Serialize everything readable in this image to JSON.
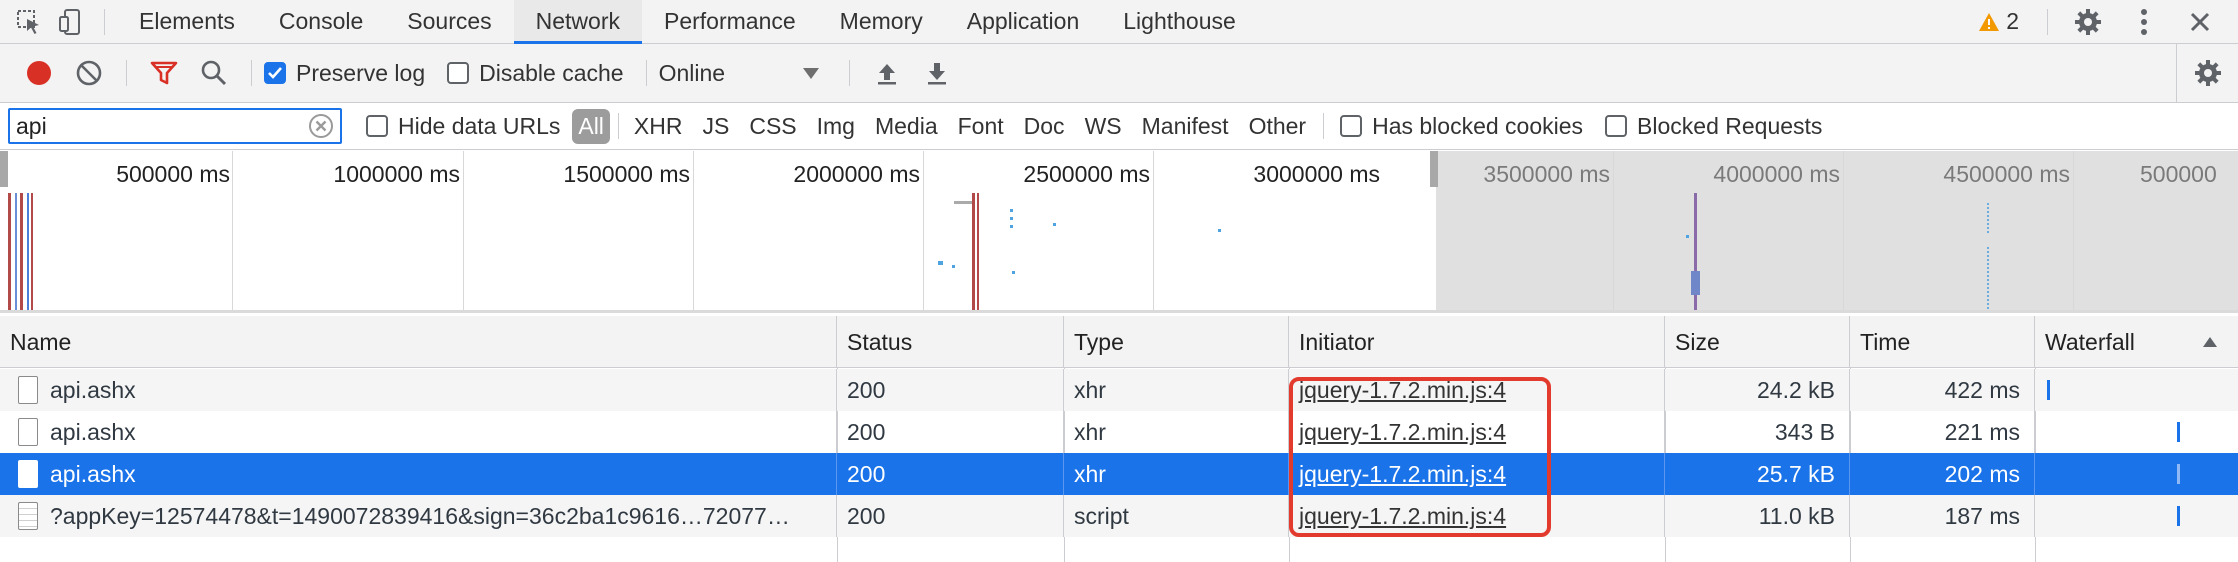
{
  "tabs": [
    {
      "label": "Elements"
    },
    {
      "label": "Console"
    },
    {
      "label": "Sources"
    },
    {
      "label": "Network",
      "active": true
    },
    {
      "label": "Performance"
    },
    {
      "label": "Memory"
    },
    {
      "label": "Application"
    },
    {
      "label": "Lighthouse"
    }
  ],
  "warnings": {
    "count": "2"
  },
  "toolbar": {
    "preserve_log": {
      "label": "Preserve log",
      "checked": true
    },
    "disable_cache": {
      "label": "Disable cache",
      "checked": false
    },
    "throttling": {
      "value": "Online"
    }
  },
  "filter": {
    "value": "api",
    "hide_data_urls": "Hide data URLs",
    "types": [
      "All",
      "XHR",
      "JS",
      "CSS",
      "Img",
      "Media",
      "Font",
      "Doc",
      "WS",
      "Manifest",
      "Other"
    ],
    "active_type": "All",
    "has_blocked_cookies": "Has blocked cookies",
    "blocked_requests": "Blocked Requests"
  },
  "overview": {
    "ticks": [
      "500000 ms",
      "1000000 ms",
      "1500000 ms",
      "2000000 ms",
      "2500000 ms",
      "3000000 ms",
      "3500000 ms",
      "4000000 ms",
      "4500000 ms",
      "500000"
    ]
  },
  "table": {
    "columns": [
      "Name",
      "Status",
      "Type",
      "Initiator",
      "Size",
      "Time",
      "Waterfall"
    ],
    "rows": [
      {
        "name": "api.ashx",
        "status": "200",
        "type": "xhr",
        "initiator": "jquery-1.7.2.min.js:4",
        "size": "24.2 kB",
        "time": "422 ms",
        "selected": false
      },
      {
        "name": "api.ashx",
        "status": "200",
        "type": "xhr",
        "initiator": "jquery-1.7.2.min.js:4",
        "size": "343 B",
        "time": "221 ms",
        "selected": false
      },
      {
        "name": "api.ashx",
        "status": "200",
        "type": "xhr",
        "initiator": "jquery-1.7.2.min.js:4",
        "size": "25.7 kB",
        "time": "202 ms",
        "selected": true
      },
      {
        "name": "?appKey=12574478&t=1490072839416&sign=36c2ba1c9616…72077…",
        "status": "200",
        "type": "script",
        "initiator": "jquery-1.7.2.min.js:4",
        "size": "11.0 kB",
        "time": "187 ms",
        "selected": false
      }
    ]
  },
  "colors": {
    "accent": "#1a73e8",
    "record": "#d93025",
    "highlight": "#e23b2e",
    "filter_funnel": "#d93025",
    "warning": "#f29900"
  }
}
